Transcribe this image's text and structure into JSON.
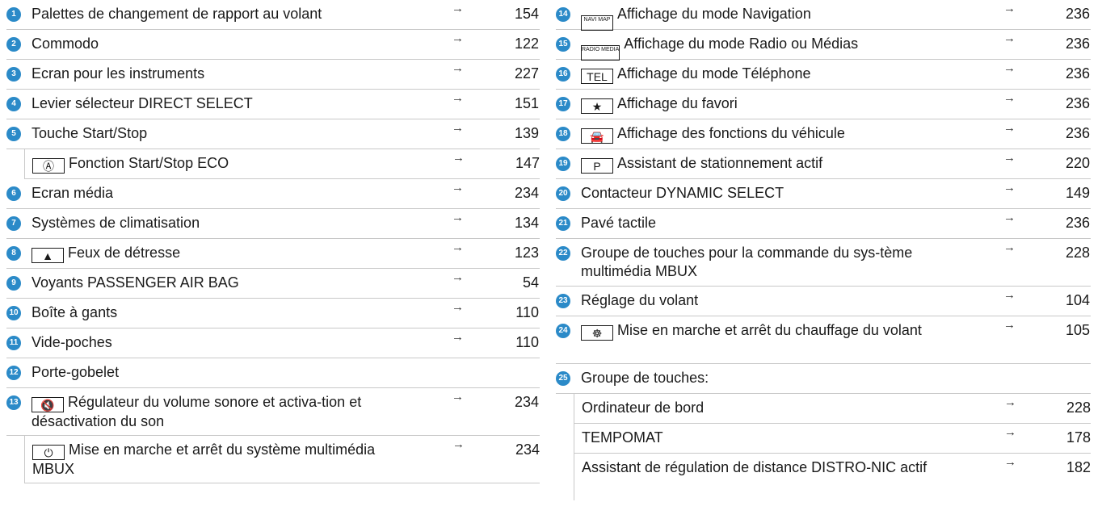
{
  "left": [
    {
      "num": "1",
      "label": "Palettes de changement de rapport au volant",
      "page": "154"
    },
    {
      "num": "2",
      "label": "Commodo",
      "page": "122"
    },
    {
      "num": "3",
      "label": "Ecran pour les instruments",
      "page": "227"
    },
    {
      "num": "4",
      "label": "Levier sélecteur DIRECT SELECT",
      "page": "151"
    },
    {
      "num": "5",
      "label": "Touche Start/Stop",
      "page": "139"
    },
    {
      "num": "",
      "icon": "Ⓐ",
      "icon_name": "eco-start-stop-icon",
      "label": "Fonction Start/Stop ECO",
      "page": "147"
    },
    {
      "num": "6",
      "label": "Ecran média",
      "page": "234"
    },
    {
      "num": "7",
      "label": "Systèmes de climatisation",
      "page": "134"
    },
    {
      "num": "8",
      "icon": "▲",
      "icon_name": "hazard-warning-icon",
      "label": "Feux de détresse",
      "page": "123"
    },
    {
      "num": "9",
      "label": "Voyants PASSENGER AIR BAG",
      "page": "54"
    },
    {
      "num": "10",
      "label": "Boîte à gants",
      "page": "110"
    },
    {
      "num": "11",
      "label": "Vide-poches",
      "page": "110"
    },
    {
      "num": "12",
      "label": "Porte-gobelet",
      "page": ""
    },
    {
      "num": "13",
      "icon": "🔇",
      "icon_name": "mute-icon",
      "label": "Régulateur du volume sonore et activa-tion et désactivation du son",
      "page": "234"
    },
    {
      "num": "",
      "icon": "⏻",
      "icon_name": "power-icon",
      "label": "Mise en marche et arrêt du système multimédia MBUX",
      "page": "234"
    }
  ],
  "right": [
    {
      "num": "14",
      "icon": "NAVI MAP",
      "icon_name": "navi-map-icon",
      "label": "Affichage du mode Navigation",
      "page": "236"
    },
    {
      "num": "15",
      "icon": "RADIO MEDIA",
      "icon_name": "radio-media-icon",
      "label": "Affichage du mode Radio ou Médias",
      "page": "236"
    },
    {
      "num": "16",
      "icon": "TEL",
      "icon_name": "tel-icon",
      "label": "Affichage du mode Téléphone",
      "page": "236"
    },
    {
      "num": "17",
      "icon": "★",
      "icon_name": "favorite-star-icon",
      "label": "Affichage du favori",
      "page": "236"
    },
    {
      "num": "18",
      "icon": "🚘",
      "icon_name": "vehicle-icon",
      "label": "Affichage des fonctions du véhicule",
      "page": "236"
    },
    {
      "num": "19",
      "icon": "P",
      "icon_name": "parking-assist-icon",
      "label": "Assistant de stationnement actif",
      "page": "220"
    },
    {
      "num": "20",
      "label": "Contacteur DYNAMIC SELECT",
      "page": "149"
    },
    {
      "num": "21",
      "label": "Pavé tactile",
      "page": "236"
    },
    {
      "num": "22",
      "label": "Groupe de touches pour la commande du sys-tème multimédia MBUX",
      "page": "228"
    },
    {
      "num": "23",
      "label": "Réglage du volant",
      "page": "104"
    },
    {
      "num": "24",
      "icon": "☸",
      "icon_name": "heated-steering-wheel-icon",
      "label": "Mise en marche et arrêt du chauffage du volant",
      "page": "105"
    },
    {
      "num": "25",
      "label": "Groupe de touches:",
      "page": ""
    },
    {
      "num": "",
      "label": "Ordinateur de bord",
      "page": "228"
    },
    {
      "num": "",
      "label": "TEMPOMAT",
      "page": "178"
    },
    {
      "num": "",
      "label": "Assistant de régulation de distance DISTRO-NIC actif",
      "page": "182"
    }
  ],
  "arrow_glyph": "→",
  "accent_color": "#2b8ac8"
}
